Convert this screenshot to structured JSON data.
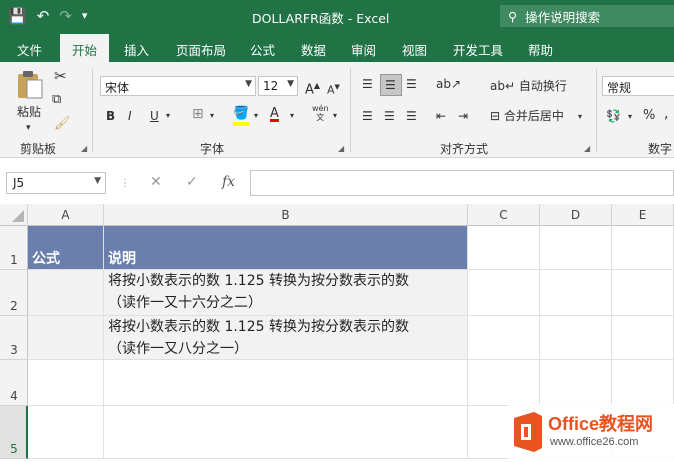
{
  "titlebar": {
    "title": "DOLLARFR函数  -  Excel",
    "tell_me": "操作说明搜索",
    "qat": {
      "save_icon": "💾",
      "undo_icon": "↶",
      "redo_icon": "↷",
      "customize_icon": "▾"
    }
  },
  "tabs": [
    "文件",
    "开始",
    "插入",
    "页面布局",
    "公式",
    "数据",
    "审阅",
    "视图",
    "开发工具",
    "帮助"
  ],
  "active_tab": "开始",
  "ribbon": {
    "clipboard": {
      "paste_label": "粘贴",
      "group_label": "剪贴板"
    },
    "font": {
      "font_name": "宋体",
      "font_size": "12",
      "bold": "B",
      "italic": "I",
      "underline": "U",
      "grow": "A",
      "shrink": "A",
      "group_label": "字体",
      "wen": "wén"
    },
    "alignment": {
      "wrap_label": "自动换行",
      "merge_label": "合并后居中",
      "group_label": "对齐方式"
    },
    "number": {
      "format": "常规",
      "group_label": "数字",
      "percent": "%",
      "comma": ","
    }
  },
  "formula_bar": {
    "name_box": "J5",
    "fx": "fx",
    "cancel": "✕",
    "enter": "✓",
    "formula": ""
  },
  "columns": [
    "A",
    "B",
    "C",
    "D",
    "E"
  ],
  "rows": [
    "1",
    "2",
    "3",
    "4",
    "5"
  ],
  "cells": {
    "A1": "公式",
    "B1": "说明",
    "B2_line1": "将按小数表示的数 1.125 转换为按分数表示的数",
    "B2_line2": "（读作一又十六分之二）",
    "B3_line1": "将按小数表示的数 1.125 转换为按分数表示的数",
    "B3_line2": "（读作一又八分之一）"
  },
  "watermark": {
    "brand": "Office教程网",
    "url": "www.office26.com"
  },
  "colors": {
    "excel_green": "#217346",
    "header_fill": "#6a7fab",
    "watermark_orange": "#e8531f"
  }
}
